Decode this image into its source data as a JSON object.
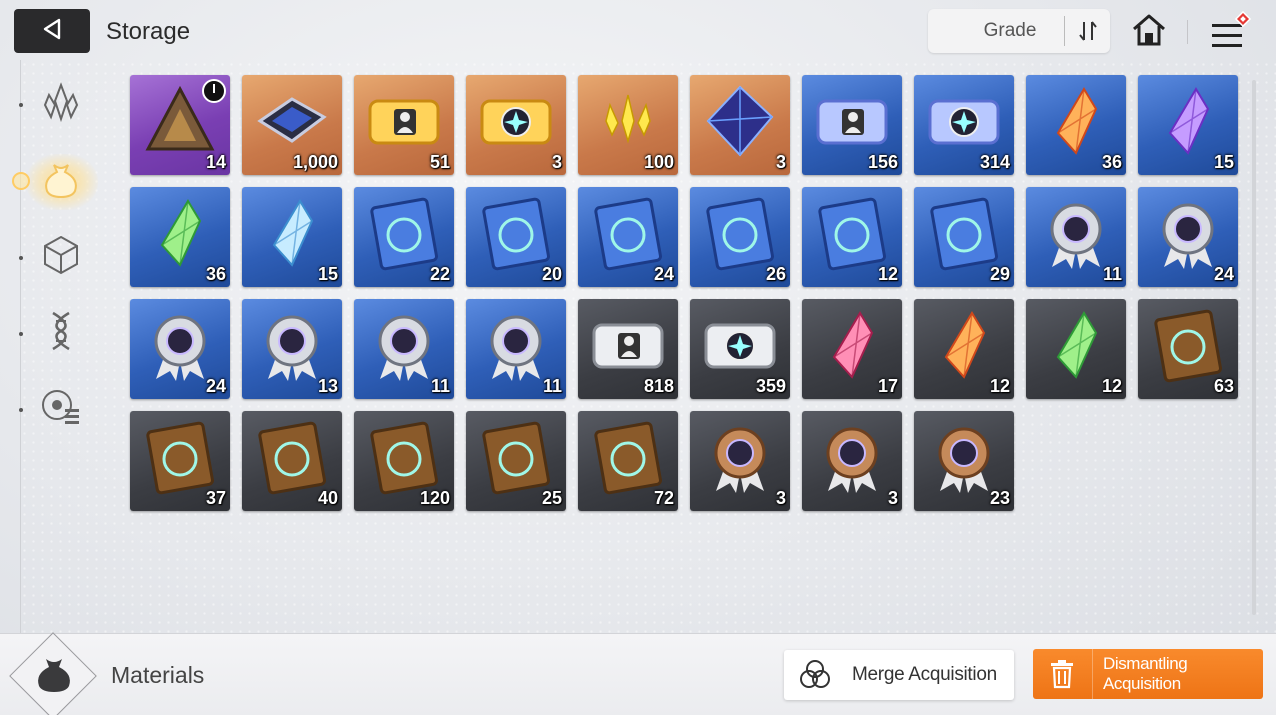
{
  "header": {
    "title": "Storage",
    "back_icon": "back-triangle-icon",
    "sort_label": "Grade",
    "home_icon": "home-icon",
    "menu_icon": "hamburger-menu-icon",
    "notification_color": "#e53935"
  },
  "sidebar": {
    "items": [
      {
        "icon": "crystal-shards-icon",
        "active": false
      },
      {
        "icon": "material-bag-icon",
        "active": true
      },
      {
        "icon": "cube-icon",
        "active": false
      },
      {
        "icon": "dna-icon",
        "active": false
      },
      {
        "icon": "disc-list-icon",
        "active": false
      }
    ],
    "active_color": "#ffd77a"
  },
  "items": [
    {
      "rarity": "purple",
      "icon": "pyramid-cube-icon",
      "qty": "14",
      "timer": true
    },
    {
      "rarity": "orange",
      "icon": "chip-plate-icon",
      "qty": "1,000"
    },
    {
      "rarity": "orange",
      "icon": "gold-character-ticket-icon",
      "qty": "51"
    },
    {
      "rarity": "orange",
      "icon": "gold-star-ticket-icon",
      "qty": "3"
    },
    {
      "rarity": "orange",
      "icon": "yellow-shards-icon",
      "qty": "100"
    },
    {
      "rarity": "orange",
      "icon": "dark-crystal-cube-icon",
      "qty": "3"
    },
    {
      "rarity": "blue",
      "icon": "holo-character-ticket-icon",
      "qty": "156"
    },
    {
      "rarity": "blue",
      "icon": "holo-star-ticket-icon",
      "qty": "314"
    },
    {
      "rarity": "blue",
      "icon": "orange-crystal-icon",
      "qty": "36"
    },
    {
      "rarity": "blue",
      "icon": "purple-crystal-icon",
      "qty": "15"
    },
    {
      "rarity": "blue",
      "icon": "green-crystal-icon",
      "qty": "36"
    },
    {
      "rarity": "blue",
      "icon": "blue-crystal-icon",
      "qty": "15"
    },
    {
      "rarity": "blue",
      "icon": "book-swords-icon",
      "qty": "22"
    },
    {
      "rarity": "blue",
      "icon": "book-shield-icon",
      "qty": "20"
    },
    {
      "rarity": "blue",
      "icon": "book-target-icon",
      "qty": "24"
    },
    {
      "rarity": "blue",
      "icon": "book-wings-icon",
      "qty": "26"
    },
    {
      "rarity": "blue",
      "icon": "book-lightning-icon",
      "qty": "12"
    },
    {
      "rarity": "blue",
      "icon": "book-crosshair-icon",
      "qty": "29"
    },
    {
      "rarity": "blue",
      "icon": "medal-swords-icon",
      "qty": "11"
    },
    {
      "rarity": "blue",
      "icon": "medal-shield-icon",
      "qty": "24"
    },
    {
      "rarity": "blue",
      "icon": "medal-target-icon",
      "qty": "24"
    },
    {
      "rarity": "blue",
      "icon": "medal-wings-icon",
      "qty": "13"
    },
    {
      "rarity": "blue",
      "icon": "medal-lightning-icon",
      "qty": "11"
    },
    {
      "rarity": "blue",
      "icon": "medal-crosshair-icon",
      "qty": "11"
    },
    {
      "rarity": "dark",
      "icon": "silver-character-ticket-icon",
      "qty": "818"
    },
    {
      "rarity": "dark",
      "icon": "silver-star-ticket-icon",
      "qty": "359"
    },
    {
      "rarity": "dark",
      "icon": "pink-crystal-icon",
      "qty": "17"
    },
    {
      "rarity": "dark",
      "icon": "red-orange-crystal-icon",
      "qty": "12"
    },
    {
      "rarity": "dark",
      "icon": "emerald-crystal-icon",
      "qty": "12"
    },
    {
      "rarity": "dark",
      "icon": "brown-book-swords-icon",
      "qty": "63"
    },
    {
      "rarity": "dark",
      "icon": "brown-book-shield-icon",
      "qty": "37"
    },
    {
      "rarity": "dark",
      "icon": "brown-book-target-icon",
      "qty": "40"
    },
    {
      "rarity": "dark",
      "icon": "brown-book-wings-icon",
      "qty": "120"
    },
    {
      "rarity": "dark",
      "icon": "brown-book-lightning-icon",
      "qty": "25"
    },
    {
      "rarity": "dark",
      "icon": "brown-book-crosshair-icon",
      "qty": "72"
    },
    {
      "rarity": "dark",
      "icon": "bronze-medal-shield-icon",
      "qty": "3"
    },
    {
      "rarity": "dark",
      "icon": "bronze-medal-target-icon",
      "qty": "3"
    },
    {
      "rarity": "dark",
      "icon": "bronze-medal-wings-icon",
      "qty": "23"
    }
  ],
  "footer": {
    "category_icon": "material-bag-icon",
    "category_label": "Materials",
    "merge_label": "Merge Acquisition",
    "merge_icon": "merge-circles-icon",
    "dismantle_label": "Dismantling Acquisition",
    "dismantle_icon": "trash-icon",
    "dismantle_color": "#f5801f"
  }
}
